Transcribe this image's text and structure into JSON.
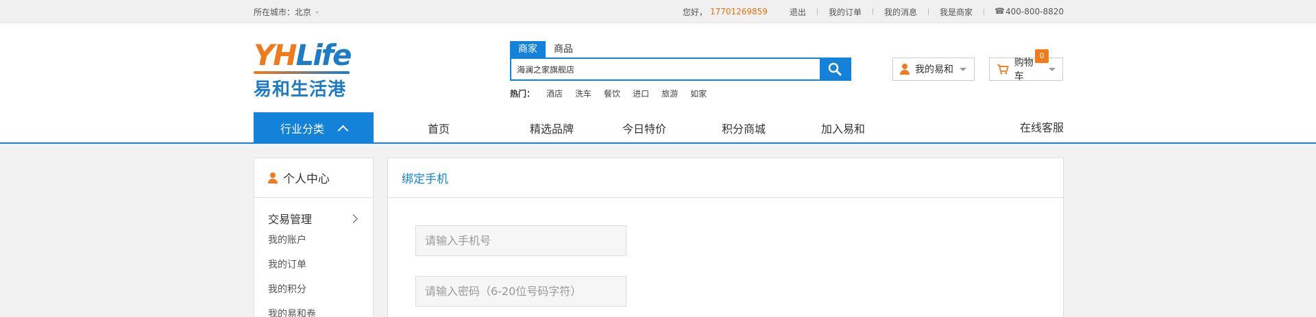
{
  "topbar": {
    "city_label": "所在城市：北京",
    "greeting": "您好，",
    "phone": "17701269859",
    "links": [
      "退出",
      "我的订单",
      "我的消息",
      "我是商家"
    ],
    "hotline": "400-800-8820"
  },
  "logo": {
    "wordmark_y": "YH",
    "wordmark_rest": "Life",
    "cn_name": "易和生活港"
  },
  "search": {
    "tabs": [
      "商家",
      "商品"
    ],
    "value": "海澜之家旗舰店",
    "hot_label": "热门：",
    "hot": [
      "酒店",
      "洗车",
      "餐饮",
      "进口",
      "旅游",
      "如家"
    ]
  },
  "header_buttons": {
    "my_yh": "我的易和",
    "cart": "购物车",
    "cart_count": "0"
  },
  "nav": {
    "category": "行业分类",
    "links": [
      "首页",
      "精选品牌",
      "今日特价",
      "积分商城",
      "加入易和"
    ],
    "service": "在线客服"
  },
  "sidebar": {
    "title": "个人中心",
    "section": "交易管理",
    "items": [
      "我的账户",
      "我的订单",
      "我的积分",
      "我的易和卷"
    ]
  },
  "panel": {
    "title": "绑定手机",
    "phone_placeholder": "请输入手机号",
    "password_placeholder": "请输入密码（6-20位号码字符）"
  },
  "colors": {
    "brand_blue": "#1482d9",
    "brand_orange": "#f07a1c"
  }
}
